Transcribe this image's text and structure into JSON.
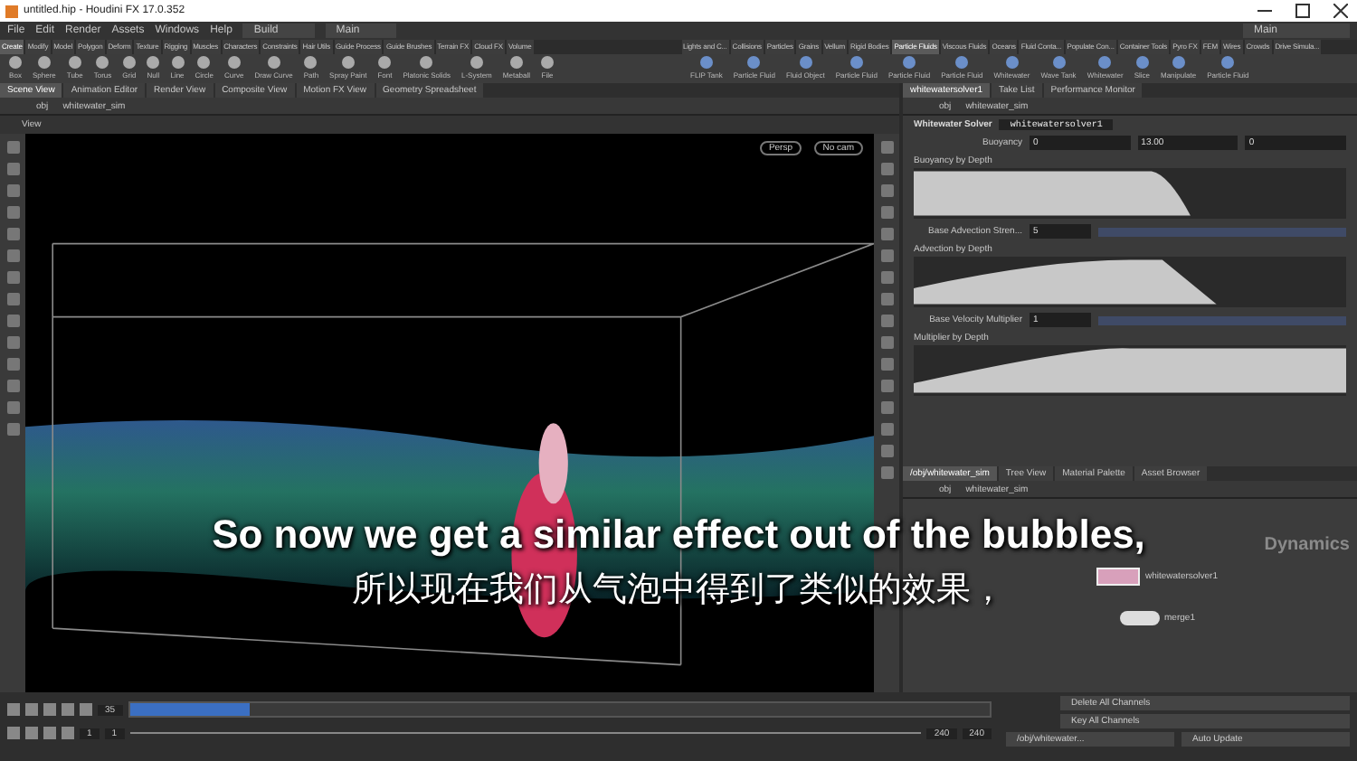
{
  "window": {
    "title": "untitled.hip - Houdini FX 17.0.352"
  },
  "menu": [
    "File",
    "Edit",
    "Render",
    "Assets",
    "Windows",
    "Help"
  ],
  "desktops": [
    {
      "label": "Build"
    },
    {
      "label": "Main"
    }
  ],
  "right_desktop": "Main",
  "shelf_tabs_left": [
    {
      "label": "Create",
      "selected": true
    },
    {
      "label": "Modify",
      "selected": false
    },
    {
      "label": "Model",
      "selected": false
    },
    {
      "label": "Polygon",
      "selected": false
    },
    {
      "label": "Deform",
      "selected": false
    },
    {
      "label": "Texture",
      "selected": false
    },
    {
      "label": "Rigging",
      "selected": false
    },
    {
      "label": "Muscles",
      "selected": false
    },
    {
      "label": "Characters",
      "selected": false
    },
    {
      "label": "Constraints",
      "selected": false
    },
    {
      "label": "Hair Utils",
      "selected": false
    },
    {
      "label": "Guide Process",
      "selected": false
    },
    {
      "label": "Guide Brushes",
      "selected": false
    },
    {
      "label": "Terrain FX",
      "selected": false
    },
    {
      "label": "Cloud FX",
      "selected": false
    },
    {
      "label": "Volume",
      "selected": false
    }
  ],
  "shelf_tabs_right": [
    {
      "label": "Lights and C...",
      "selected": false
    },
    {
      "label": "Collisions",
      "selected": false
    },
    {
      "label": "Particles",
      "selected": false
    },
    {
      "label": "Grains",
      "selected": false
    },
    {
      "label": "Vellum",
      "selected": false
    },
    {
      "label": "Rigid Bodies",
      "selected": false
    },
    {
      "label": "Particle Fluids",
      "selected": true
    },
    {
      "label": "Viscous Fluids",
      "selected": false
    },
    {
      "label": "Oceans",
      "selected": false
    },
    {
      "label": "Fluid Conta...",
      "selected": false
    },
    {
      "label": "Populate Con...",
      "selected": false
    },
    {
      "label": "Container Tools",
      "selected": false
    },
    {
      "label": "Pyro FX",
      "selected": false
    },
    {
      "label": "FEM",
      "selected": false
    },
    {
      "label": "Wires",
      "selected": false
    },
    {
      "label": "Crowds",
      "selected": false
    },
    {
      "label": "Drive Simula...",
      "selected": false
    }
  ],
  "shelf_tools_left": [
    "Box",
    "Sphere",
    "Tube",
    "Torus",
    "Grid",
    "Null",
    "Line",
    "Circle",
    "Curve",
    "Draw Curve",
    "Path",
    "Spray Paint",
    "Font",
    "Platonic Solids",
    "L-System",
    "Metaball",
    "File"
  ],
  "shelf_tools_right": [
    "FLIP Tank",
    "Particle Fluid",
    "Fluid Object",
    "Particle Fluid",
    "Particle Fluid",
    "Particle Fluid",
    "Whitewater",
    "Wave Tank",
    "Whitewater",
    "Slice",
    "Manipulate",
    "Particle Fluid"
  ],
  "pane_tabs_left": [
    {
      "label": "Scene View",
      "selected": true
    },
    {
      "label": "Animation Editor",
      "selected": false
    },
    {
      "label": "Render View",
      "selected": false
    },
    {
      "label": "Composite View",
      "selected": false
    },
    {
      "label": "Motion FX View",
      "selected": false
    },
    {
      "label": "Geometry Spreadsheet",
      "selected": false
    }
  ],
  "pane_tabs_right": [
    {
      "label": "whitewatersolver1",
      "selected": true
    },
    {
      "label": "Take List",
      "selected": false
    },
    {
      "label": "Performance Monitor",
      "selected": false
    }
  ],
  "scene_path": [
    "obj",
    "whitewater_sim"
  ],
  "param_path": [
    "obj",
    "whitewater_sim"
  ],
  "viewport": {
    "menu": "View",
    "camera": "Persp",
    "cam_menu": "No cam"
  },
  "params": {
    "type": "Whitewater Solver",
    "node": "whitewatersolver1",
    "rows": [
      {
        "kind": "vector",
        "label": "Buoyancy",
        "values": [
          "0",
          "13.00",
          "0"
        ]
      },
      {
        "kind": "ramp",
        "label": "Buoyancy by Depth"
      },
      {
        "kind": "slider",
        "label": "Base Advection Stren...",
        "value": "5"
      },
      {
        "kind": "ramp",
        "label": "Advection by Depth"
      },
      {
        "kind": "slider",
        "label": "Base Velocity Multiplier",
        "value": "1"
      },
      {
        "kind": "ramp",
        "label": "Multiplier by Depth"
      }
    ]
  },
  "network": {
    "tabs": [
      {
        "label": "/obj/whitewater_sim",
        "selected": true
      },
      {
        "label": "Tree View",
        "selected": false
      },
      {
        "label": "Material Palette",
        "selected": false
      },
      {
        "label": "Asset Browser",
        "selected": false
      }
    ],
    "path": [
      "obj",
      "whitewater_sim"
    ],
    "context": "Dynamics",
    "nodes": [
      {
        "label": "whitewatersolver1",
        "kind": "solver"
      },
      {
        "label": "merge1",
        "kind": "merge"
      }
    ]
  },
  "timeline": {
    "frame": "35",
    "range_start": "1",
    "range_start2": "1",
    "end": "240",
    "end2": "240",
    "level": 0.14
  },
  "channels": [
    "Delete All Channels",
    "Key All Channels"
  ],
  "status": {
    "path": "/obj/whitewater...",
    "update": "Auto Update"
  },
  "subtitles": [
    "So now we get a similar effect out of the bubbles,",
    "所以现在我们从气泡中得到了类似的效果，"
  ]
}
